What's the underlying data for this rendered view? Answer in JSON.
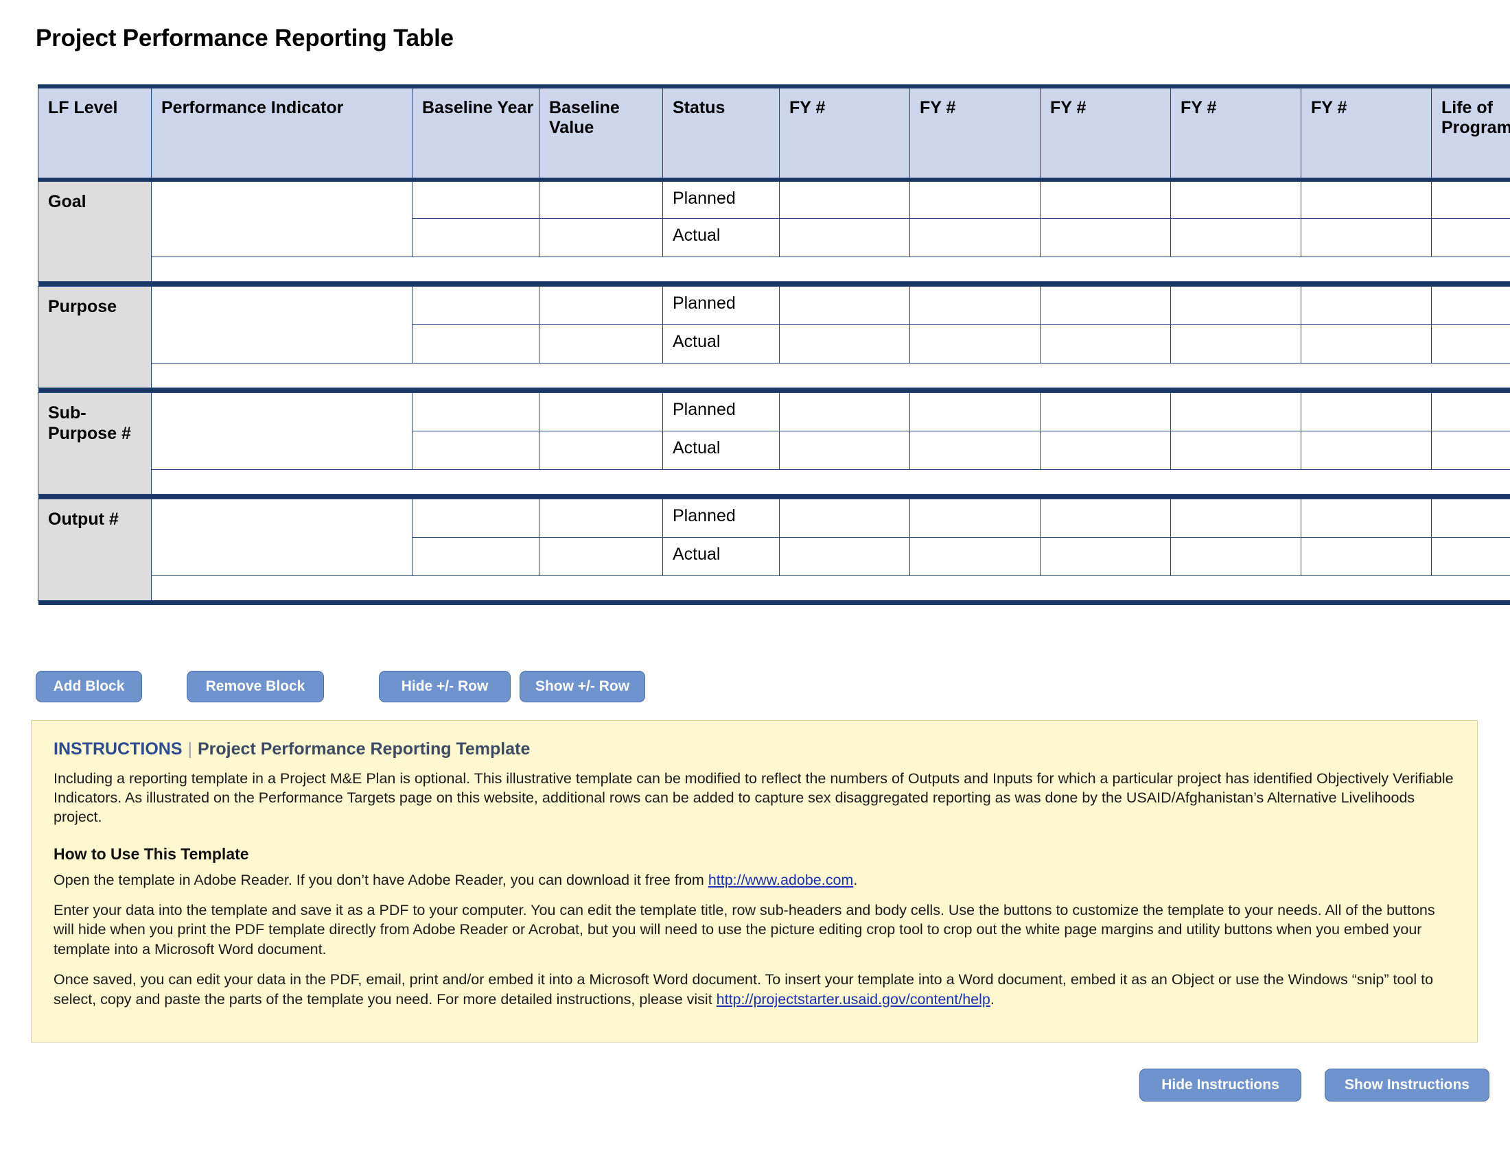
{
  "page_title": "Project Performance Reporting Table",
  "table": {
    "columns": [
      {
        "key": "lf_level",
        "label": "LF Level"
      },
      {
        "key": "indicator",
        "label": "Performance Indicator"
      },
      {
        "key": "baseline_yr",
        "label": "Baseline Year"
      },
      {
        "key": "baseline_vl",
        "label": "Baseline Value"
      },
      {
        "key": "status",
        "label": "Status"
      },
      {
        "key": "fy1",
        "label": "FY #"
      },
      {
        "key": "fy2",
        "label": "FY #"
      },
      {
        "key": "fy3",
        "label": "FY #"
      },
      {
        "key": "fy4",
        "label": "FY #"
      },
      {
        "key": "fy5",
        "label": "FY #"
      },
      {
        "key": "lop",
        "label": "Life of Program"
      }
    ],
    "blocks": [
      {
        "level": "Goal",
        "indicator": "",
        "baseline_year": "",
        "baseline_value": "",
        "rows": [
          {
            "status": "Planned",
            "fy1": "",
            "fy2": "",
            "fy3": "",
            "fy4": "",
            "fy5": "",
            "lop": ""
          },
          {
            "status": "Actual",
            "fy1": "",
            "fy2": "",
            "fy3": "",
            "fy4": "",
            "fy5": "",
            "lop": ""
          }
        ]
      },
      {
        "level": "Purpose",
        "indicator": "",
        "baseline_year": "",
        "baseline_value": "",
        "rows": [
          {
            "status": "Planned",
            "fy1": "",
            "fy2": "",
            "fy3": "",
            "fy4": "",
            "fy5": "",
            "lop": ""
          },
          {
            "status": "Actual",
            "fy1": "",
            "fy2": "",
            "fy3": "",
            "fy4": "",
            "fy5": "",
            "lop": ""
          }
        ]
      },
      {
        "level": "Sub-Purpose #",
        "indicator": "",
        "baseline_year": "",
        "baseline_value": "",
        "rows": [
          {
            "status": "Planned",
            "fy1": "",
            "fy2": "",
            "fy3": "",
            "fy4": "",
            "fy5": "",
            "lop": ""
          },
          {
            "status": "Actual",
            "fy1": "",
            "fy2": "",
            "fy3": "",
            "fy4": "",
            "fy5": "",
            "lop": ""
          }
        ]
      },
      {
        "level": "Output #",
        "indicator": "",
        "baseline_year": "",
        "baseline_value": "",
        "rows": [
          {
            "status": "Planned",
            "fy1": "",
            "fy2": "",
            "fy3": "",
            "fy4": "",
            "fy5": "",
            "lop": ""
          },
          {
            "status": "Actual",
            "fy1": "",
            "fy2": "",
            "fy3": "",
            "fy4": "",
            "fy5": "",
            "lop": ""
          }
        ]
      }
    ],
    "row_controls": {
      "add_label": "+",
      "remove_label": "–"
    }
  },
  "toolbar": {
    "add_block": "Add Block",
    "remove_block": "Remove Block",
    "hide_pm_row": "Hide +/- Row",
    "show_pm_row": "Show +/- Row"
  },
  "instructions": {
    "keyword": "INSTRUCTIONS",
    "separator": "|",
    "subtitle": "Project Performance Reporting Template",
    "intro": "Including a reporting template in a Project M&E Plan is optional. This illustrative template can be modified to reflect the numbers of Outputs and Inputs for which a particular project has identified Objectively Verifiable Indicators. As illustrated on the Performance Targets page on this website, additional rows can be added to capture sex disaggregated reporting as was done by the USAID/Afghanistan’s Alternative Livelihoods project.",
    "howto_heading": "How to Use This Template",
    "p1_before_link": "Open the template in Adobe Reader. If you don’t have Adobe Reader, you can download it free from ",
    "p1_link": "http://www.adobe.com",
    "p1_after_link": ".",
    "p2": "Enter your data into the template and save it as a PDF to your computer. You can edit the template title, row sub-headers and body cells. Use the buttons to customize the template to your needs. All of the buttons will hide when you print the PDF template directly from Adobe Reader or Acrobat, but you will need to use the picture editing crop tool to crop out the white page margins and utility buttons when you embed your template into a Microsoft Word document.",
    "p3_before_link": "Once saved, you can edit your data in the PDF, email, print and/or embed it into a Microsoft Word document. To insert your template into a Word document, embed it as an Object or use the Windows “snip” tool to select, copy and paste the parts of the template you need. For more detailed instructions, please visit ",
    "p3_link": "http://projectstarter.usaid.gov/content/help",
    "p3_after_link": "."
  },
  "bottom_buttons": {
    "hide_instructions": "Hide Instructions",
    "show_instructions": "Show Instructions"
  },
  "colors": {
    "header_bg": "#ccd5e9",
    "rule_navy": "#1b3766",
    "lf_bg": "#dddddd",
    "button_blue": "#6f93cd",
    "instructions_bg": "#fdf8cf",
    "link_blue": "#1a2fb5"
  }
}
